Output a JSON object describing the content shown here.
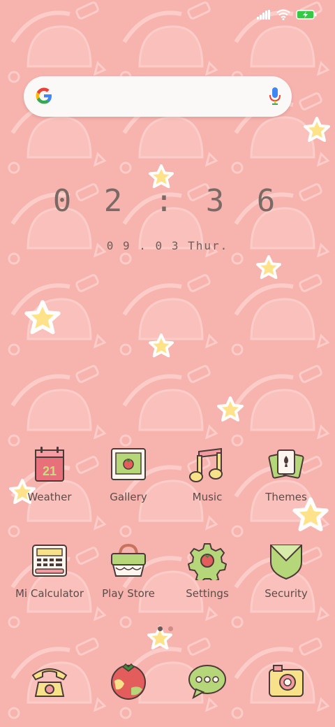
{
  "status_bar": {
    "signal_icon": "cellular-signal-icon",
    "wifi_icon": "wifi-icon",
    "battery_icon": "battery-charging-icon",
    "battery_color": "#37c846"
  },
  "search_widget": {
    "logo_icon": "google-g-icon",
    "mic_icon": "microphone-icon"
  },
  "clock": {
    "time": "0 2 : 3 6",
    "date": "0 9 . 0 3   Thur."
  },
  "home_apps": [
    {
      "label": "Weather",
      "icon": "calendar-weather-icon",
      "calendar_day": "21"
    },
    {
      "label": "Gallery",
      "icon": "picture-frame-icon"
    },
    {
      "label": "Music",
      "icon": "music-note-icon"
    },
    {
      "label": "Themes",
      "icon": "playing-cards-icon"
    },
    {
      "label": "Mi Calculator",
      "icon": "calculator-icon"
    },
    {
      "label": "Play Store",
      "icon": "shopping-basket-icon"
    },
    {
      "label": "Settings",
      "icon": "gear-icon"
    },
    {
      "label": "Security",
      "icon": "shield-icon"
    }
  ],
  "page_indicator": {
    "pages": 2,
    "active": 1
  },
  "dock": [
    {
      "name": "phone",
      "icon": "telephone-icon"
    },
    {
      "name": "browser",
      "icon": "globe-tomato-icon"
    },
    {
      "name": "messages",
      "icon": "chat-bubble-icon"
    },
    {
      "name": "camera",
      "icon": "camera-icon"
    }
  ],
  "colors": {
    "wallpaper": "#f7b3ae",
    "pattern": "#fbcbc6",
    "star_fill": "#ffe28a",
    "label_text": "#5b4c49"
  }
}
